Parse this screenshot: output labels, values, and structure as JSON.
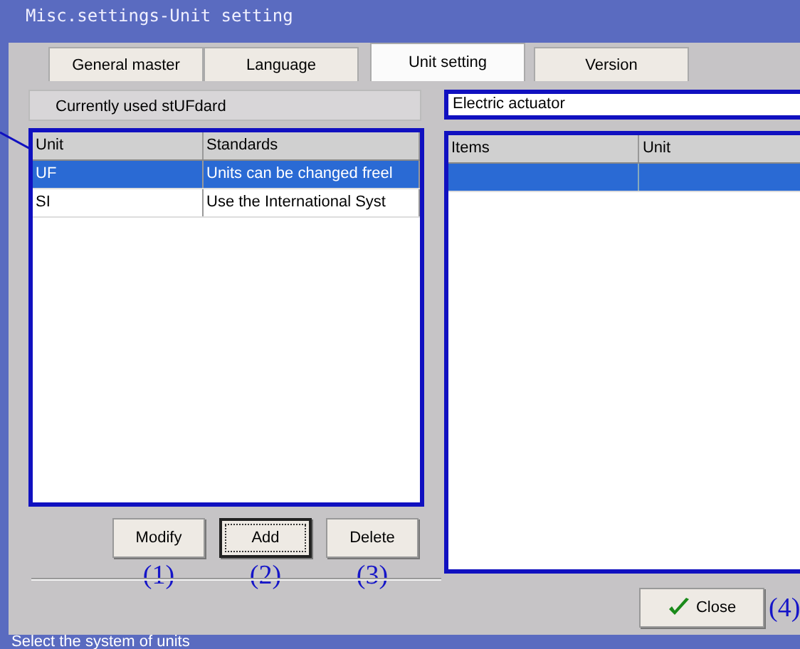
{
  "window": {
    "title": "Misc.settings-Unit setting"
  },
  "tabs": [
    {
      "label": "General master",
      "selected": false
    },
    {
      "label": "Language",
      "selected": false
    },
    {
      "label": "Unit setting",
      "selected": true
    },
    {
      "label": "Version",
      "selected": false
    }
  ],
  "current_standard_label": "Currently used stUFdard",
  "units_table": {
    "columns": [
      "Unit",
      "Standards"
    ],
    "rows": [
      {
        "cells": [
          "UF",
          "Units can be changed freel"
        ],
        "selected": true
      },
      {
        "cells": [
          "SI",
          "Use the International Syst"
        ],
        "selected": false
      }
    ]
  },
  "buttons": [
    {
      "label": "Modify",
      "focused": false,
      "note": "(1)"
    },
    {
      "label": "Add",
      "focused": true,
      "note": "(2)"
    },
    {
      "label": "Delete",
      "focused": false,
      "note": "(3)"
    }
  ],
  "category_dropdown": {
    "value": "Electric actuator"
  },
  "items_table": {
    "columns": [
      "Items",
      "Unit"
    ]
  },
  "close_button": {
    "label": "Close",
    "note": "(4)"
  },
  "status_bar": "Select the system of units"
}
